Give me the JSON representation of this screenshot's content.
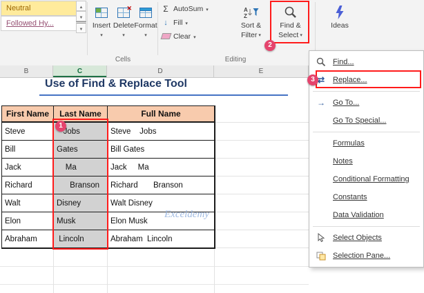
{
  "watermark": "Exceldemy",
  "ribbon": {
    "styles": {
      "items": [
        "Neutral",
        "Followed Hy..."
      ]
    },
    "cells": {
      "group_label": "Cells",
      "buttons": [
        "Insert",
        "Delete",
        "Format"
      ]
    },
    "editing": {
      "group_label": "Editing",
      "autosum": "AutoSum",
      "fill": "Fill",
      "clear": "Clear",
      "sort_filter": [
        "Sort &",
        "Filter"
      ],
      "find_select": [
        "Find &",
        "Select"
      ]
    },
    "ideas": {
      "label": "Ideas"
    }
  },
  "menu": {
    "items": [
      {
        "label": "Find...",
        "icon": "magnifier"
      },
      {
        "label": "Replace...",
        "icon": "replace-arrows"
      },
      {
        "label": "Go To...",
        "icon": "right-arrow"
      },
      {
        "label": "Go To Special...",
        "icon": ""
      },
      {
        "label": "Formulas",
        "icon": ""
      },
      {
        "label": "Notes",
        "icon": ""
      },
      {
        "label": "Conditional Formatting",
        "icon": ""
      },
      {
        "label": "Constants",
        "icon": ""
      },
      {
        "label": "Data Validation",
        "icon": ""
      },
      {
        "label": "Select Objects",
        "icon": "cursor"
      },
      {
        "label": "Selection Pane...",
        "icon": "panes"
      }
    ]
  },
  "sheet": {
    "title": "Use of Find & Replace Tool",
    "column_headers": [
      "B",
      "C",
      "D",
      "E"
    ],
    "table": {
      "headers": [
        "First Name",
        "Last Name",
        "Full Name"
      ],
      "rows": [
        {
          "first": "Steve",
          "last": "   Jobs",
          "full": "Steve    Jobs"
        },
        {
          "first": "Bill",
          "last": "Gates",
          "full": "Bill Gates"
        },
        {
          "first": "Jack",
          "last": "    Ma",
          "full": "Jack     Ma"
        },
        {
          "first": "Richard",
          "last": "      Branson",
          "full": "Richard       Branson"
        },
        {
          "first": "Walt",
          "last": "Disney",
          "full": "Walt Disney"
        },
        {
          "first": "Elon",
          "last": "Musk",
          "full": "Elon Musk"
        },
        {
          "first": "Abraham",
          "last": " Lincoln",
          "full": "Abraham  Lincoln"
        }
      ]
    }
  },
  "annotations": {
    "steps": [
      "1",
      "2",
      "3"
    ],
    "box_color": "#FF0000",
    "badge_color": "#E5446D"
  },
  "colors": {
    "table_header_fill": "#F8CBAD",
    "selected_cells_fill": "#D2D2D2",
    "title_color": "#1F3864",
    "neutral_fill": "#FFEB9C",
    "neutral_text": "#9C6500",
    "followed_hyperlink_text": "#954F72",
    "selected_column_header": "#D7E8D9"
  }
}
